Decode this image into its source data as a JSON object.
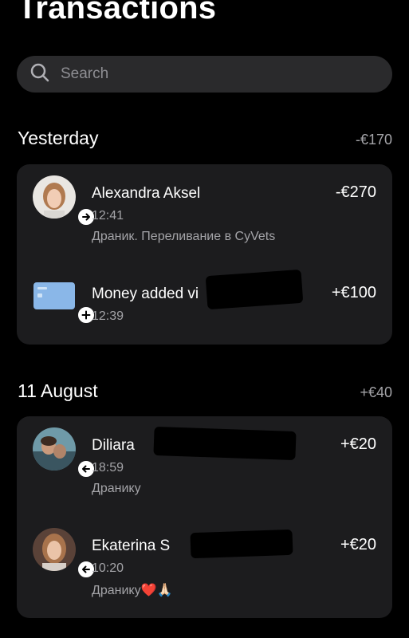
{
  "header": {
    "title": "Transactions"
  },
  "search": {
    "placeholder": "Search"
  },
  "sections": [
    {
      "title": "Yesterday",
      "total": "-€170",
      "transactions": [
        {
          "name": "Alexandra Aksel",
          "amount": "-€270",
          "time": "12:41",
          "note": "Драник. Переливание в CyVets",
          "icon": "avatar-photo",
          "badge": "arrow-right-icon"
        },
        {
          "name": "Money added vi",
          "amount": "+€100",
          "time": "12:39",
          "icon": "bank-card-icon",
          "badge": "plus-icon"
        }
      ]
    },
    {
      "title": "11 August",
      "total": "+€40",
      "transactions": [
        {
          "name": "Diliara",
          "amount": "+€20",
          "time": "18:59",
          "note": "Дранику",
          "icon": "avatar-photo",
          "badge": "arrow-left-icon"
        },
        {
          "name": "Ekaterina S",
          "amount": "+€20",
          "time": "10:20",
          "note": "Дранику❤️🙏🏻",
          "icon": "avatar-photo",
          "badge": "arrow-left-icon"
        }
      ]
    }
  ],
  "colors": {
    "background": "#000000",
    "card": "#1c1c1e",
    "search": "#2a2a2c",
    "secondary_text": "#a4a4a8"
  }
}
